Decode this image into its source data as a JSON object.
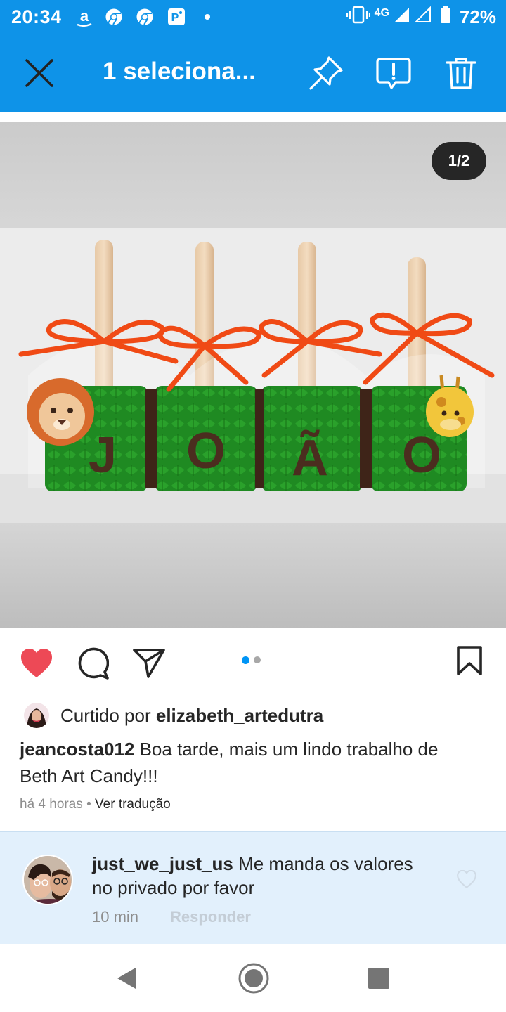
{
  "status_bar": {
    "time": "20:34",
    "network": "4G",
    "battery": "72%",
    "notification_icons": [
      "amazon-icon",
      "chrome-icon",
      "chrome-icon",
      "app-p-icon",
      "dot-icon"
    ]
  },
  "action_bar": {
    "title": "1 seleciona...",
    "icons": [
      "close-icon",
      "pin-icon",
      "report-icon",
      "trash-icon"
    ]
  },
  "post": {
    "image_counter": "1/2",
    "carousel": {
      "count": 2,
      "active_index": 0
    },
    "liked": true,
    "liked_by_prefix": "Curtido por",
    "liked_by_user": "elizabeth_artedutra",
    "author": "jeancosta012",
    "caption": "Boa tarde, mais um lindo trabalho de Beth Art Candy!!!",
    "time_ago": "há 4 horas",
    "separator": "•",
    "translate_label": "Ver tradução",
    "photo_letters": [
      "J",
      "O",
      "Ã",
      "O"
    ]
  },
  "comment": {
    "user": "just_we_just_us",
    "text": "Me manda os valores no privado por favor",
    "time": "10 min",
    "reply_label": "Responder"
  },
  "colors": {
    "accent": "#0e93e8",
    "like_red": "#ed4956",
    "dot_active": "#0095f6",
    "comment_bg": "#e2f0fc"
  },
  "nav_bar": {
    "icons": [
      "back-icon",
      "home-icon",
      "recents-icon"
    ]
  }
}
